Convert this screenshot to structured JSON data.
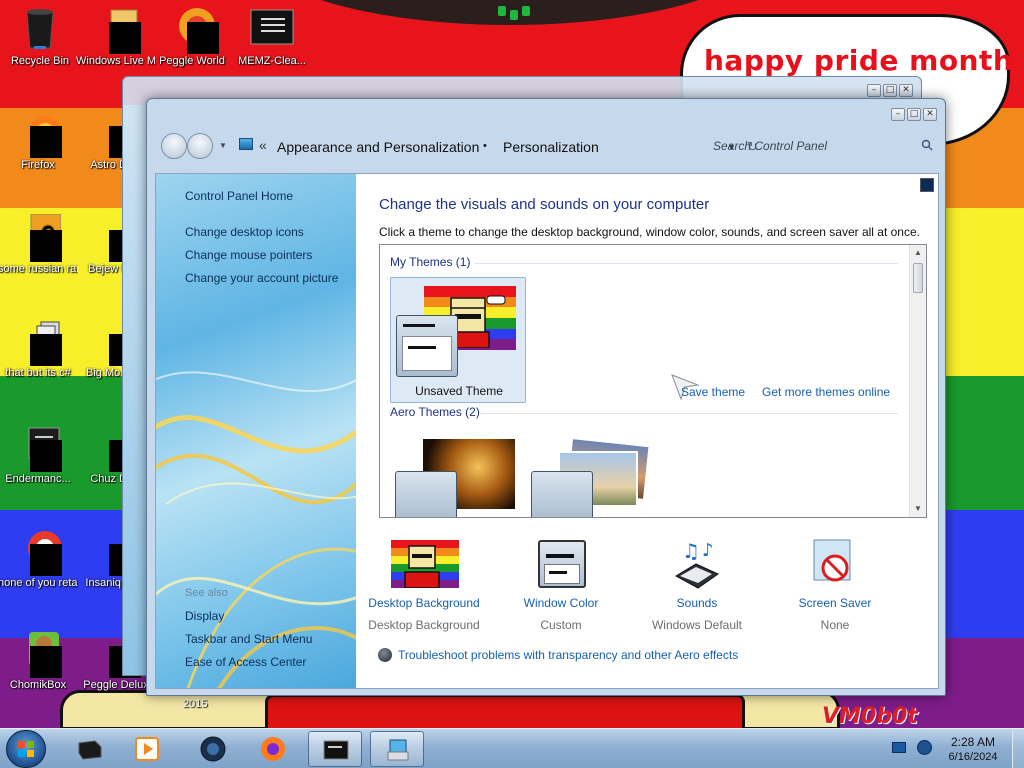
{
  "wallpaper": {
    "stripes": [
      "#e8141c",
      "#f18a1a",
      "#f6ef2a",
      "#1a9a2c",
      "#2f3df0",
      "#7e1c8a"
    ],
    "bubble_text": "happy pride month",
    "watermark_text": "VM0b0t",
    "year_text": "2015"
  },
  "desktop_icons": [
    {
      "label": "Recycle Bin"
    },
    {
      "label": "Windows Live Ma..."
    },
    {
      "label": "Peggle World"
    },
    {
      "label": "MEMZ-Clea..."
    },
    {
      "label": "Firefox"
    },
    {
      "label": "Astro Delu"
    },
    {
      "label": "some russian ran a rat"
    },
    {
      "label": "Bejew Delu"
    },
    {
      "label": "that but its c#"
    },
    {
      "label": "Big Mo Delu"
    },
    {
      "label": "Endermanc..."
    },
    {
      "label": "Chuz Delu"
    },
    {
      "label": "none of you retards kno..."
    },
    {
      "label": "Insaniq Delu"
    },
    {
      "label": "ChomikBox"
    },
    {
      "label": "Peggle Delux"
    }
  ],
  "window": {
    "caption_buttons": [
      "–",
      "□",
      "✕"
    ],
    "address": {
      "chevron": "«",
      "segments": [
        "Appearance and Personalization",
        "•",
        "Personalization"
      ],
      "dropdown": "▼",
      "refresh": "↻"
    },
    "search_placeholder": "Search Control Panel"
  },
  "left_pane": {
    "links": [
      "Control Panel Home",
      "Change desktop icons",
      "Change mouse pointers",
      "Change your account picture"
    ],
    "see_also_header": "See also",
    "see_also_links": [
      "Display",
      "Taskbar and Start Menu",
      "Ease of Access Center"
    ]
  },
  "main": {
    "title": "Change the visuals and sounds on your computer",
    "description": "Click a theme to change the desktop background, window color, sounds, and screen saver all at once.",
    "my_themes_header": "My Themes (1)",
    "selected_theme": "Unsaved Theme",
    "save_theme": "Save theme",
    "get_more_themes": "Get more themes online",
    "aero_themes_header": "Aero Themes (2)"
  },
  "settings": [
    {
      "label": "Desktop Background",
      "value": "Desktop Background",
      "icon": "desktop-background-icon"
    },
    {
      "label": "Window Color",
      "value": "Custom",
      "icon": "window-color-icon"
    },
    {
      "label": "Sounds",
      "value": "Windows Default",
      "icon": "sounds-icon"
    },
    {
      "label": "Screen Saver",
      "value": "None",
      "icon": "screen-saver-icon"
    }
  ],
  "troubleshoot_link": "Troubleshoot problems with transparency and other Aero effects",
  "taskbar": {
    "clock_time": "2:28 AM",
    "clock_date": "6/16/2024"
  }
}
